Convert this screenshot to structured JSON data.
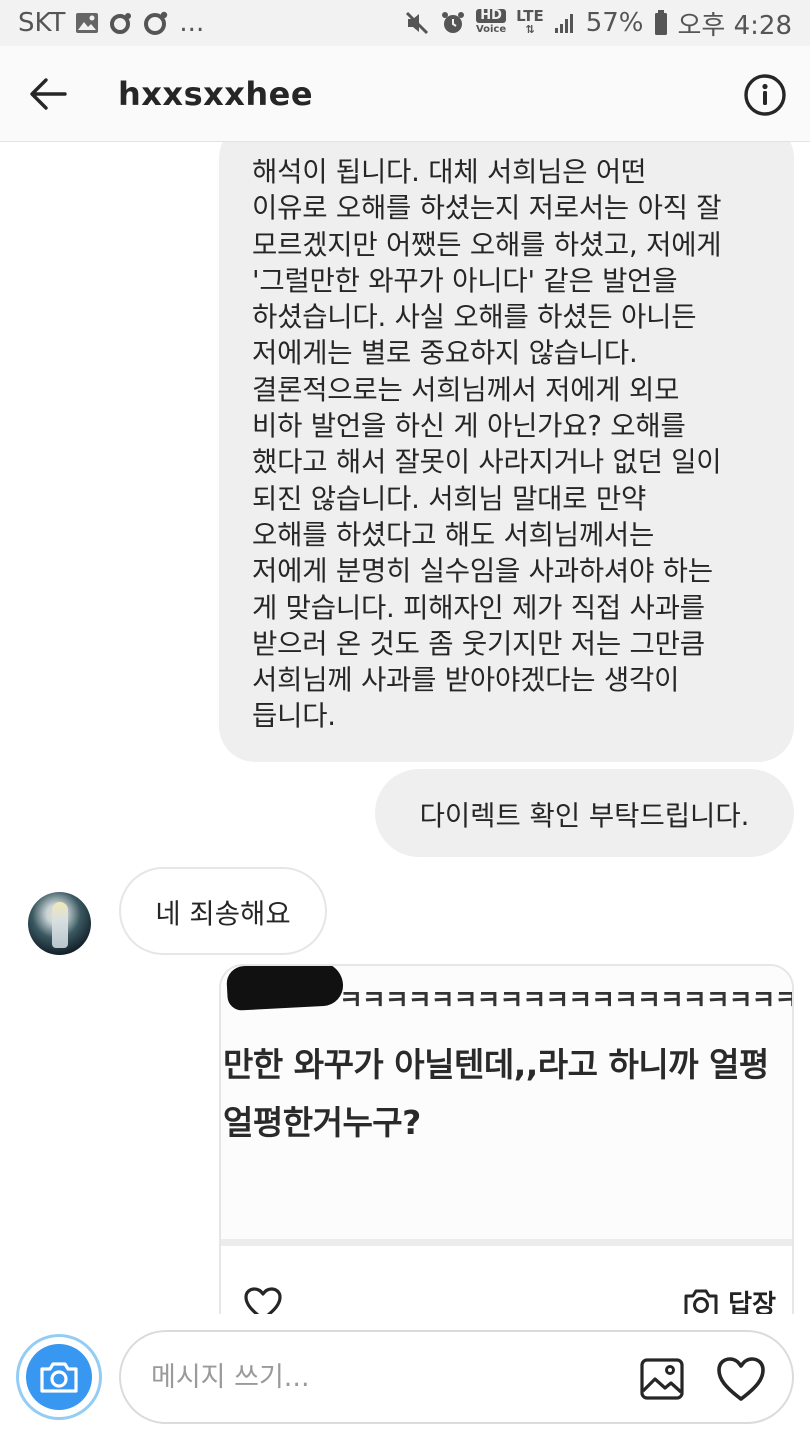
{
  "status_bar": {
    "carrier": "SKT",
    "dots": "...",
    "hd_top": "HD",
    "hd_bottom": "Voice",
    "lte": "LTE",
    "battery": "57%",
    "time": "오후 4:28"
  },
  "header": {
    "username": "hxxsxxhee",
    "back_icon": "arrow-left-icon",
    "info_icon": "info-circle-icon"
  },
  "messages": {
    "long_lines": [
      "해석이 됩니다. 대체 서희님은 어떤",
      "이유로 오해를 하셨는지 저로서는 아직 잘",
      "모르겠지만 어쨌든 오해를 하셨고, 저에게",
      "'그럴만한 와꾸가 아니다' 같은 발언을",
      "하셨습니다. 사실 오해를 하셨든 아니든",
      "저에게는 별로 중요하지 않습니다.",
      "결론적으로는 서희님께서 저에게 외모",
      "비하 발언을 하신 게 아닌가요? 오해를",
      "했다고 해서 잘못이 사라지거나 없던 일이",
      "되진 않습니다. 서희님 말대로 만약",
      "오해를 하셨다고 해도 서희님께서는",
      "저에게 분명히 실수임을 사과하셔야 하는",
      "게 맞습니다. 피해자인 제가 직접 사과를",
      "받으러 온 것도 좀 웃기지만 저는 그만큼",
      "서희님께 사과를 받아야겠다는 생각이",
      "듭니다."
    ],
    "sent_short": "다이렉트 확인 부탁드립니다.",
    "received": "네 죄송해요"
  },
  "shared_post": {
    "line1": "ㅋㅋㅋㅋㅋㅋㅋㅋㅋㅋㅋㅋㅋㅋㅋㅋㅋㅋㅋㅋㅋㅋㅋㅋ",
    "line2": "만한 와꾸가 아닐텐데,,라고 하니까 얼평",
    "line3": "얼평한거누구?",
    "reply_label": "답장"
  },
  "composer": {
    "placeholder": "메시지 쓰기...",
    "camera_icon": "camera-icon",
    "gallery_icon": "image-icon",
    "like_icon": "heart-icon"
  },
  "colors": {
    "accent_blue": "#3897f0",
    "bubble_gray": "#efefef",
    "text": "#262626"
  }
}
